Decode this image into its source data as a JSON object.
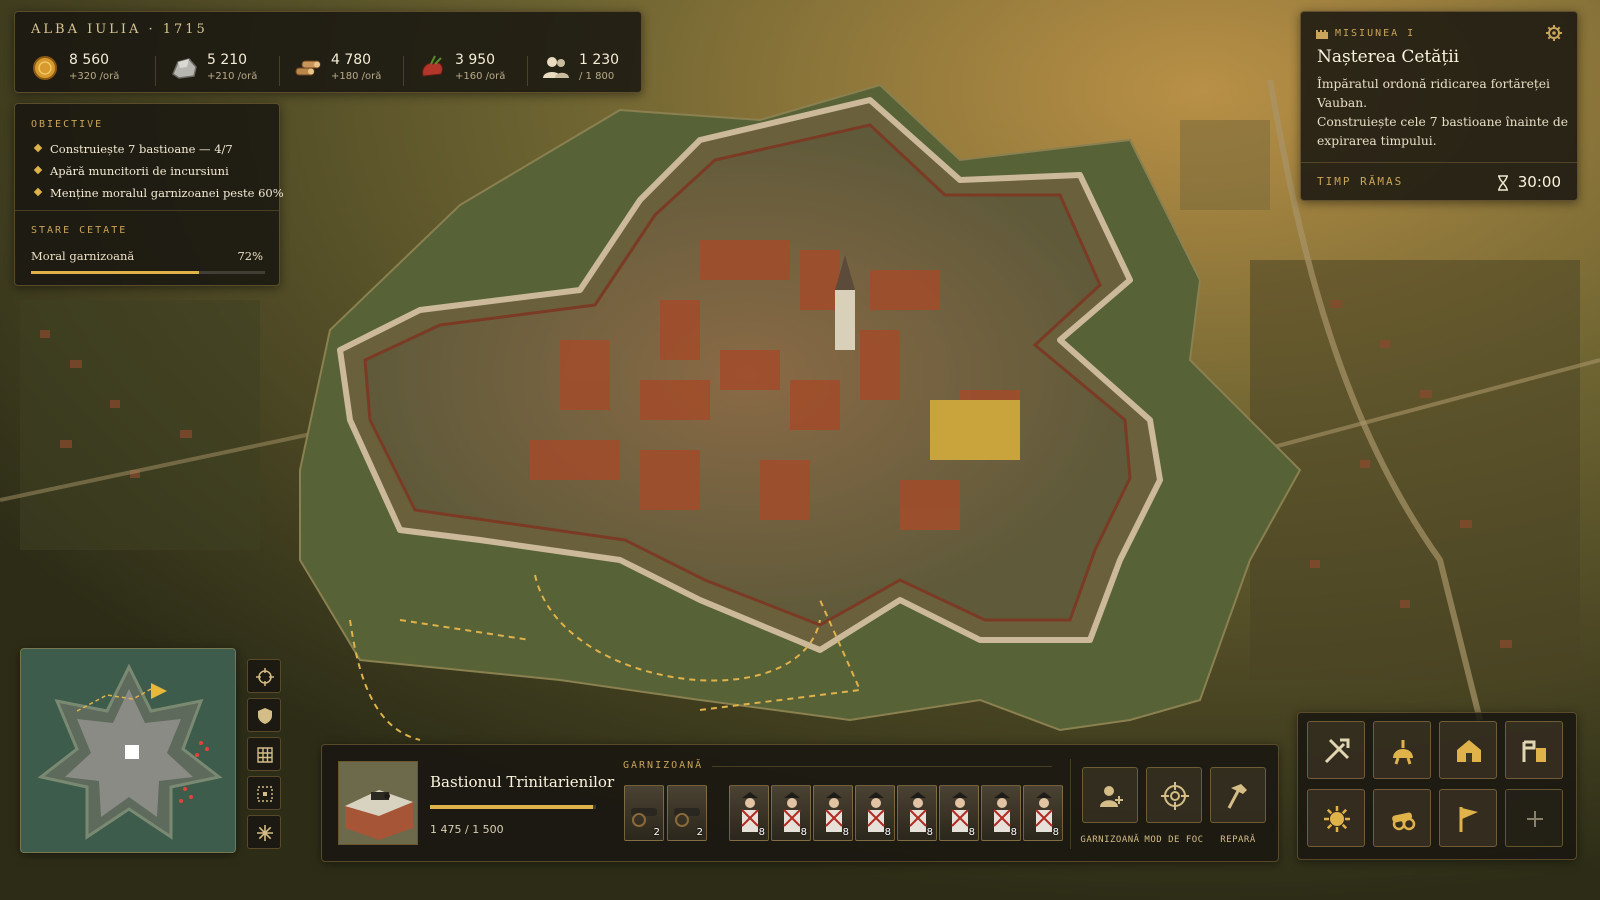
{
  "hud": {
    "city_title": "ALBA IULIA · 1715",
    "resources": [
      {
        "icon": "gold-coin-icon",
        "value": "8 560",
        "rate": "+320 /oră"
      },
      {
        "icon": "stone-icon",
        "value": "5 210",
        "rate": "+210 /oră"
      },
      {
        "icon": "wood-logs-icon",
        "value": "4 780",
        "rate": "+180 /oră"
      },
      {
        "icon": "food-icon",
        "value": "3 950",
        "rate": "+160 /oră"
      },
      {
        "icon": "population-icon",
        "value": "1 230",
        "rate": "/ 1 800"
      }
    ]
  },
  "objectives": {
    "heading": "OBIECTIVE",
    "items": [
      "Construiește 7 bastioane — 4/7",
      "Apără muncitorii de incursiuni",
      "Menține moralul garnizoanei peste 60%"
    ],
    "status_heading": "STARE CETATE",
    "morale_label": "Moral garnizoană",
    "morale_value": "72%",
    "morale_fraction": 0.72
  },
  "mission": {
    "kicker": "MISIUNEA I",
    "title": "Nașterea Cetății",
    "body_1": "Împăratul ordonă ridicarea fortăreței Vauban.",
    "body_2": "Construiește cele 7 bastioane înainte de expirarea timpului.",
    "time_label": "TIMP RĂMAS",
    "time_value": "30:00"
  },
  "selection": {
    "name": "Bastionul Trinitarienilor",
    "hp_text": "1 475 / 1 500",
    "hp_fraction": 0.983,
    "garrison_label": "GARNIZOANĂ",
    "cannons": [
      {
        "count": "2"
      },
      {
        "count": "2"
      }
    ],
    "soldiers": [
      {
        "count": "8"
      },
      {
        "count": "8"
      },
      {
        "count": "8"
      },
      {
        "count": "8"
      },
      {
        "count": "8"
      },
      {
        "count": "8"
      },
      {
        "count": "8"
      },
      {
        "count": "8"
      }
    ],
    "actions": [
      {
        "icon": "add-soldier-icon",
        "label": "GARNIZOANĂ"
      },
      {
        "icon": "crosshair-icon",
        "label": "MOD DE FOC"
      },
      {
        "icon": "hammer-icon",
        "label": "REPARĂ"
      }
    ]
  },
  "build_menu": [
    {
      "icon": "hammer-pick-icon"
    },
    {
      "icon": "helmet-icon"
    },
    {
      "icon": "house-icon"
    },
    {
      "icon": "gate-icon"
    },
    {
      "icon": "sun-emblem-icon"
    },
    {
      "icon": "cannon-icon"
    },
    {
      "icon": "flag-icon"
    },
    {
      "icon": "plus-icon"
    }
  ],
  "colors": {
    "accent_gold": "#e0b24a",
    "panel_bg": "#18160f",
    "text_light": "#efe6cf"
  }
}
